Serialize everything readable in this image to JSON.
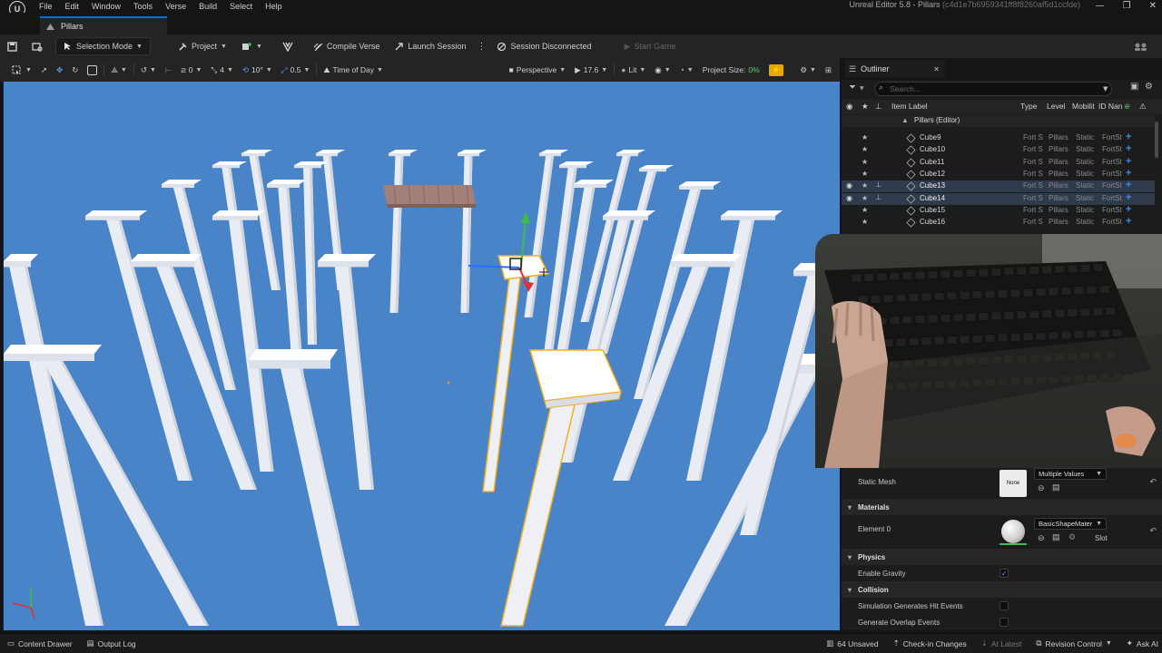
{
  "menu": [
    "File",
    "Edit",
    "Window",
    "Tools",
    "Verse",
    "Build",
    "Select",
    "Help"
  ],
  "window": {
    "title": "Unreal Editor 5.8 - Pillars",
    "hash": "(c4d1e7b6959341ff8f8260af5d1ccfde)",
    "minimize": "—",
    "restore": "❐",
    "close": "✕"
  },
  "logo_text": "U",
  "tab": {
    "label": "Pillars"
  },
  "toolbar": {
    "selection_mode": "Selection Mode",
    "project": "Project",
    "compile_verse": "Compile Verse",
    "launch_session": "Launch Session",
    "session_status": "Session Disconnected",
    "start_game": "Start Game"
  },
  "viewport_toolbar": {
    "grid_snap": "0",
    "scale_snap": "4",
    "rotation_snap": "10°",
    "camera_speed_snap": "0.5",
    "time_of_day": "Time of Day",
    "perspective": "Perspective",
    "fov": "17.6",
    "lit": "Lit",
    "project_size_label": "Project Size:",
    "project_size_value": "0%"
  },
  "outliner": {
    "tab_label": "Outliner",
    "close": "✕",
    "search_placeholder": "Search...",
    "columns": {
      "label": "Item Label",
      "type": "Type",
      "level": "Level",
      "mobility": "Mobilit",
      "id": "ID Nan"
    },
    "root": "Pillars (Editor)",
    "rows": [
      {
        "label": "Cube9",
        "type": "Fort S",
        "level": "Pillars",
        "mobility": "Static",
        "id": "FortSt",
        "selected": false
      },
      {
        "label": "Cube10",
        "type": "Fort S",
        "level": "Pillars",
        "mobility": "Static",
        "id": "FortSt",
        "selected": false
      },
      {
        "label": "Cube11",
        "type": "Fort S",
        "level": "Pillars",
        "mobility": "Static",
        "id": "FortSt",
        "selected": false
      },
      {
        "label": "Cube12",
        "type": "Fort S",
        "level": "Pillars",
        "mobility": "Static",
        "id": "FortSt",
        "selected": false
      },
      {
        "label": "Cube13",
        "type": "Fort S",
        "level": "Pillars",
        "mobility": "Static",
        "id": "FortSt",
        "selected": true
      },
      {
        "label": "Cube14",
        "type": "Fort S",
        "level": "Pillars",
        "mobility": "Static",
        "id": "FortSt",
        "selected": true
      },
      {
        "label": "Cube15",
        "type": "Fort S",
        "level": "Pillars",
        "mobility": "Static",
        "id": "FortSt",
        "selected": false
      },
      {
        "label": "Cube16",
        "type": "Fort S",
        "level": "Pillars",
        "mobility": "Static",
        "id": "FortSt",
        "selected": false
      }
    ]
  },
  "details": {
    "static_mesh_label": "Static Mesh",
    "static_mesh_thumb": "None",
    "static_mesh_value": "Multiple Values",
    "materials_section": "Materials",
    "element0_label": "Element 0",
    "element0_value": "BasicShapeMater",
    "slot_label": "Slot",
    "physics_section": "Physics",
    "enable_gravity_label": "Enable Gravity",
    "enable_gravity_checked": true,
    "collision_section": "Collision",
    "sim_hit_events_label": "Simulation Generates Hit Events",
    "overlap_events_label": "Generate Overlap Events"
  },
  "statusbar": {
    "content_drawer": "Content Drawer",
    "output_log": "Output Log",
    "unsaved": "64 Unsaved",
    "check_in": "Check-in Changes",
    "at_latest": "At Latest",
    "revision_control": "Revision Control",
    "ask_ai": "Ask AI"
  },
  "colors": {
    "viewport_sky": "#4a84c8",
    "pillar": "#f2f4f8",
    "selection_outline": "#f0b020",
    "accent_blue": "#2c8cff"
  }
}
